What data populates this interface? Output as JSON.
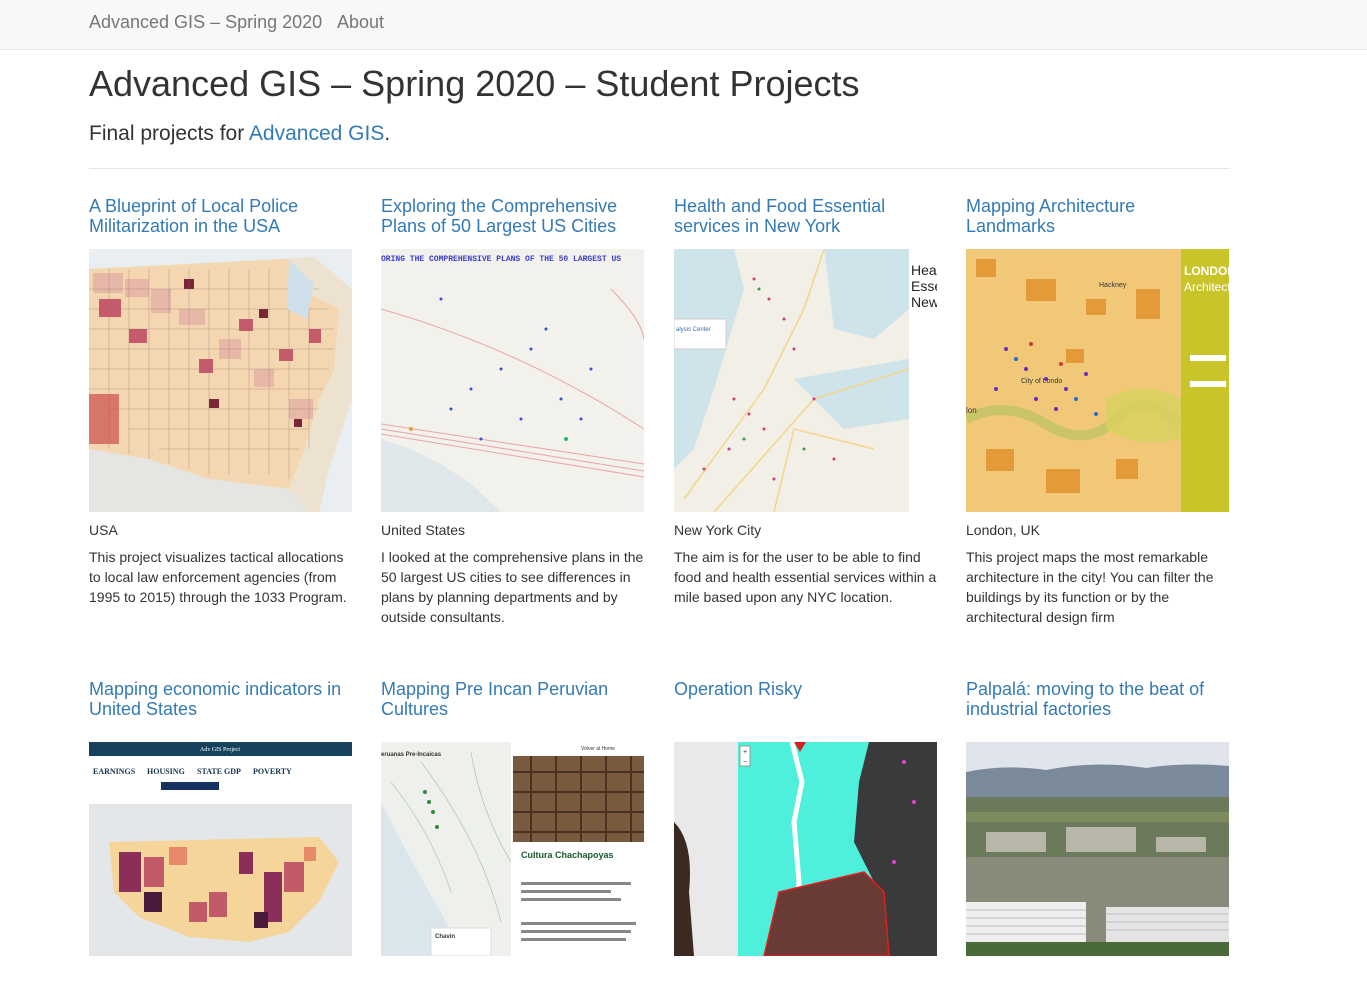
{
  "navbar": {
    "brand": "Advanced GIS – Spring 2020",
    "about": "About"
  },
  "header": {
    "title": "Advanced GIS – Spring 2020 – Student Projects",
    "subtitle_prefix": "Final projects for ",
    "subtitle_link": "Advanced GIS",
    "subtitle_suffix": "."
  },
  "projects": [
    {
      "title": "A Blueprint of Local Police Militarization in the USA",
      "location": "USA",
      "description": "This project visualizes tactical allocations to local law enforcement agencies (from 1995 to 2015) through the 1033 Program.",
      "thumb_icon": "choropleth-map-thumbnail"
    },
    {
      "title": "Exploring the Comprehensive Plans of 50 Largest US Cities",
      "location": "United States",
      "description": "I looked at the comprehensive plans in the 50 largest US cities to see differences in plans by planning departments and by outside consultants.",
      "thumb_text": "ORING THE COMPREHENSIVE PLANS OF THE 50 LARGEST US"
    },
    {
      "title": "Health and Food Essential services in New York",
      "location": "New York City",
      "description": "The aim is for the user to be able to find food and health essential services within a mile based upon any NYC location.",
      "thumb_text": "alysis Center",
      "thumb_side_text": [
        "Hea",
        "Esse",
        "New"
      ]
    },
    {
      "title": "Mapping Architecture Landmarks",
      "location": "London, UK",
      "description": "This project maps the most remarkable architecture in the city! You can filter the buildings by its function or by the architectural design firm",
      "thumb_side_text": [
        "LONDON",
        "Architect"
      ],
      "thumb_map_labels": [
        "Hackney",
        "City of Londo",
        "lon"
      ]
    },
    {
      "title": "Mapping economic indicators in United States",
      "thumb_header": "Adv GIS Project",
      "thumb_tabs": [
        "EARNINGS",
        "HOUSING",
        "STATE GDP",
        "POVERTY"
      ]
    },
    {
      "title": "Mapping Pre Incan Peruvian Cultures",
      "thumb_heading": "Cultura Chachapoyas",
      "thumb_top_text": "Volver al Home",
      "thumb_side_title": "eruanas Pre-Incaicas",
      "thumb_card_label": "Chavin"
    },
    {
      "title": "Operation Risky"
    },
    {
      "title": "Palpalá: moving to the beat of industrial factories"
    }
  ]
}
